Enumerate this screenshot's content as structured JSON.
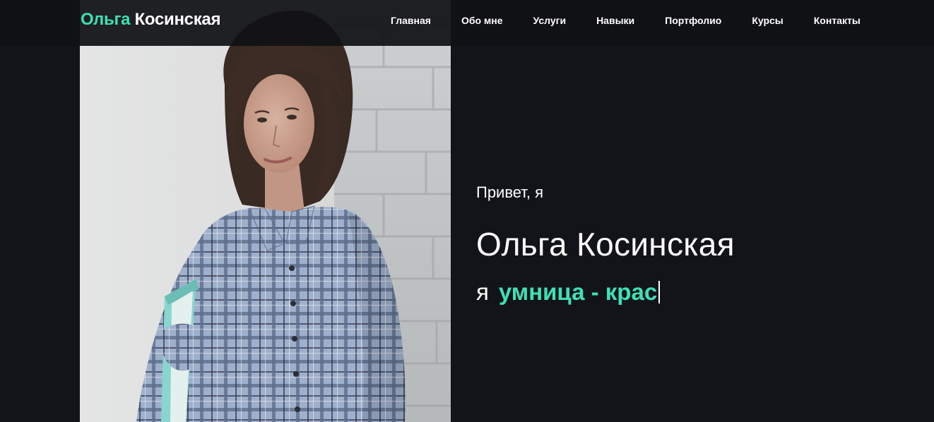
{
  "header": {
    "logo_first": "Ольга",
    "logo_last": "Косинская",
    "nav": [
      "Главная",
      "Обо мне",
      "Услуги",
      "Навыки",
      "Портфолио",
      "Курсы",
      "Контакты"
    ]
  },
  "hero": {
    "greeting": "Привет, я",
    "name": "Ольга Косинская",
    "tagline_prefix": "я",
    "tagline_typed": "умница - крас"
  },
  "colors": {
    "accent": "#3ee0b5",
    "background": "#131419",
    "header_background": "#101114",
    "text": "#ffffff"
  },
  "icons": [
    "text-caret"
  ]
}
